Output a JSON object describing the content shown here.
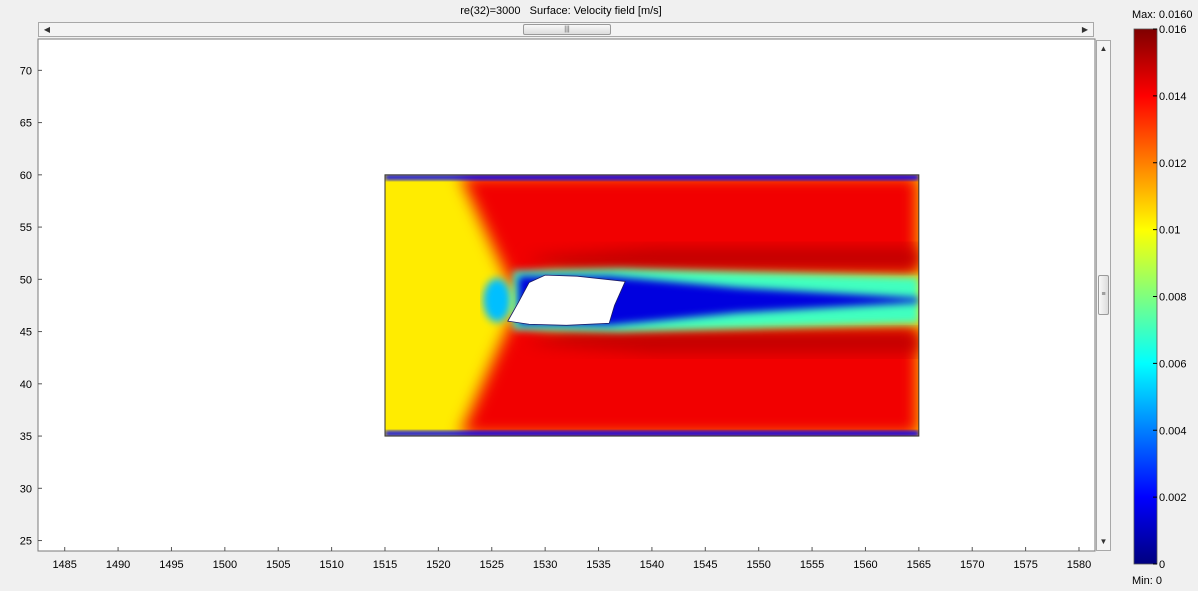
{
  "plot": {
    "title": "re(32)=3000   Surface: Velocity field [m/s]"
  },
  "colorbar": {
    "max_label": "Max: 0.0160",
    "min_label": "Min: 0"
  },
  "scrollbars": {
    "h_left_icon": "triangle-left-icon",
    "h_right_icon": "triangle-right-icon",
    "v_up_icon": "triangle-up-icon",
    "v_down_icon": "triangle-down-icon",
    "grip_icon": "grip-icon"
  },
  "chart_data": {
    "type": "heatmap",
    "title": "re(32)=3000   Surface: Velocity field [m/s]",
    "xlabel": "",
    "ylabel": "",
    "xlim": [
      1482.5,
      1581.5
    ],
    "ylim": [
      24.0,
      73.0
    ],
    "xticks": [
      1485,
      1490,
      1495,
      1500,
      1505,
      1510,
      1515,
      1520,
      1525,
      1530,
      1535,
      1540,
      1545,
      1550,
      1555,
      1560,
      1565,
      1570,
      1575,
      1580
    ],
    "yticks": [
      25,
      30,
      35,
      40,
      45,
      50,
      55,
      60,
      65,
      70
    ],
    "domain": {
      "x": [
        1515,
        1565
      ],
      "y": [
        35,
        60
      ]
    },
    "obstacle_polygon": [
      [
        1526.5,
        46.0
      ],
      [
        1527.5,
        47.8
      ],
      [
        1528.5,
        49.7
      ],
      [
        1530.0,
        50.4
      ],
      [
        1533.0,
        50.3
      ],
      [
        1537.5,
        49.8
      ],
      [
        1536.5,
        47.5
      ],
      [
        1536.0,
        45.8
      ],
      [
        1532.0,
        45.6
      ],
      [
        1528.5,
        45.7
      ]
    ],
    "colorbar": {
      "min": 0,
      "max": 0.016,
      "max_label": "Max: 0.0160",
      "min_label": "Min: 0",
      "ticks": [
        0,
        0.002,
        0.004,
        0.006,
        0.008,
        0.01,
        0.012,
        0.014,
        0.016
      ],
      "tick_labels": [
        "0",
        "0.002",
        "0.004",
        "0.006",
        "0.008",
        "0.01",
        "0.012",
        "0.014",
        "0.016"
      ],
      "colormap": "jet",
      "colormap_stops": [
        "#00007f",
        "#0000ff",
        "#007fff",
        "#00ffff",
        "#7fff7f",
        "#ffff00",
        "#ff7f00",
        "#ff0000",
        "#7f0000"
      ]
    },
    "grid": false,
    "legend": "colorbar-right"
  }
}
